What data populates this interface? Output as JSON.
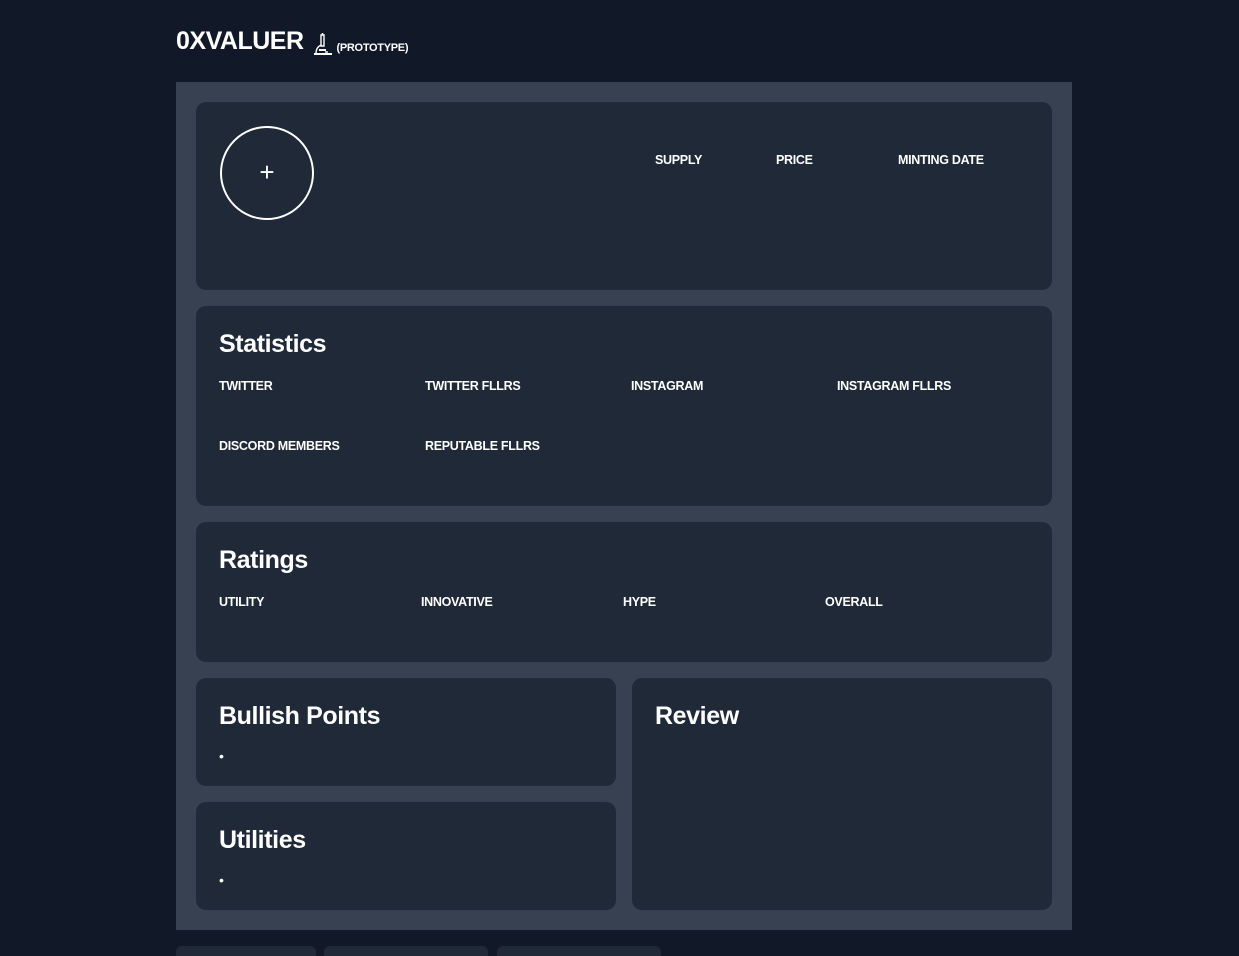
{
  "header": {
    "brand": "0XVALUER",
    "tag": "(PROTOTYPE)",
    "icon": "microscope-icon"
  },
  "overview": {
    "upload_symbol": "+",
    "supply_label": "SUPPLY",
    "price_label": "PRICE",
    "minting_date_label": "MINTING DATE"
  },
  "statistics": {
    "title": "Statistics",
    "twitter": "TWITTER",
    "twitter_fllrs": "TWITTER FLLRS",
    "instagram": "INSTAGRAM",
    "instagram_fllrs": "INSTAGRAM FLLRS",
    "discord_members": "DISCORD MEMBERS",
    "reputable_fllrs": "REPUTABLE FLLRS"
  },
  "ratings": {
    "title": "Ratings",
    "utility": "UTILITY",
    "innovative": "INNOVATIVE",
    "hype": "HYPE",
    "overall": "OVERALL"
  },
  "bullish": {
    "title": "Bullish Points",
    "bullet": "•"
  },
  "utilities": {
    "title": "Utilities",
    "bullet": "•"
  },
  "review": {
    "title": "Review"
  }
}
